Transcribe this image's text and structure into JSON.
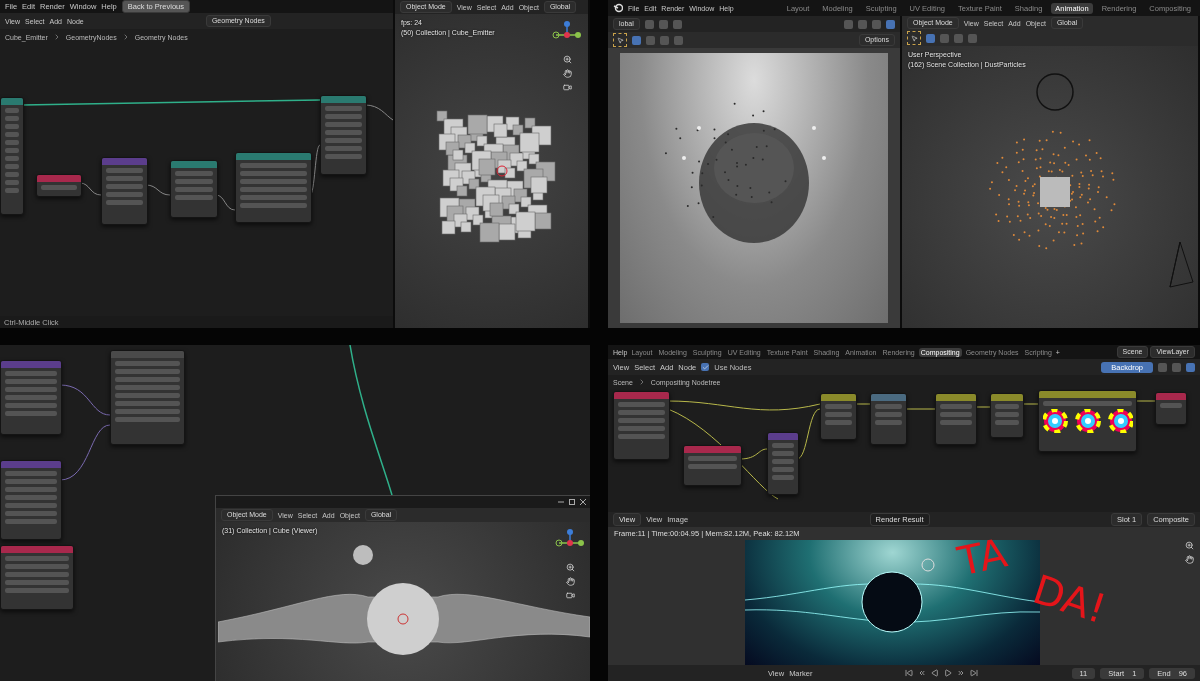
{
  "top_left": {
    "menu": [
      "File",
      "Edit",
      "Render",
      "Window",
      "Help"
    ],
    "back_button": "Back to Previous",
    "editor_menus": [
      "View",
      "Select",
      "Add",
      "Node"
    ],
    "node_group": "Geometry Nodes",
    "breadcrumb": [
      "Cube_Emitter",
      "GeometryNodes",
      "Geometry Nodes"
    ],
    "nodes": [
      {
        "color": "#2a7a70"
      },
      {
        "color": "#a8284c"
      },
      {
        "color": "#5b3d8c"
      },
      {
        "color": "#2a7a70"
      },
      {
        "color": "#2a7a70"
      },
      {
        "color": "#2a7a70"
      }
    ],
    "status": "Ctrl-Middle Click",
    "viewport": {
      "mode": "Object Mode",
      "menus": [
        "View",
        "Select",
        "Add",
        "Object"
      ],
      "orientation": "Global",
      "overlay": [
        "fps: 24",
        "(50) Collection | Cube_Emitter"
      ]
    }
  },
  "top_right": {
    "menu": [
      "File",
      "Edit",
      "Render",
      "Window",
      "Help"
    ],
    "workspace_tabs": [
      {
        "label": "Layout",
        "selected": false
      },
      {
        "label": "Modeling",
        "selected": false
      },
      {
        "label": "Sculpting",
        "selected": false
      },
      {
        "label": "UV Editing",
        "selected": false
      },
      {
        "label": "Texture Paint",
        "selected": false
      },
      {
        "label": "Shading",
        "selected": false
      },
      {
        "label": "Animation",
        "selected": true
      },
      {
        "label": "Rendering",
        "selected": false
      },
      {
        "label": "Compositing",
        "selected": false
      }
    ],
    "left_viewport": {
      "orientation": "lobal",
      "options": "Options"
    },
    "right_viewport": {
      "mode": "Object Mode",
      "menus": [
        "View",
        "Select",
        "Add",
        "Object"
      ],
      "orientation": "Global",
      "overlay": [
        "User Perspective",
        "(162) Scene Collection | DustParticles"
      ]
    }
  },
  "bottom_left": {
    "nodes": [
      {
        "color": "#5b3d8c"
      },
      {
        "color": "#4a4a4a"
      },
      {
        "color": "#5b3d8c"
      },
      {
        "color": "#a8284c"
      }
    ],
    "viewport_window": {
      "mode": "Object Mode",
      "menus": [
        "View",
        "Select",
        "Add",
        "Object"
      ],
      "orientation": "Global",
      "overlay": [
        "(31) Collection | Cube (Viewer)"
      ]
    }
  },
  "bottom_right": {
    "menu": [
      "Help"
    ],
    "workspace_tabs": [
      {
        "label": "Layout",
        "selected": false
      },
      {
        "label": "Modeling",
        "selected": false
      },
      {
        "label": "Sculpting",
        "selected": false
      },
      {
        "label": "UV Editing",
        "selected": false
      },
      {
        "label": "Texture Paint",
        "selected": false
      },
      {
        "label": "Shading",
        "selected": false
      },
      {
        "label": "Animation",
        "selected": false
      },
      {
        "label": "Rendering",
        "selected": false
      },
      {
        "label": "Compositing",
        "selected": true
      },
      {
        "label": "Geometry Nodes",
        "selected": false
      },
      {
        "label": "Scripting",
        "selected": false
      }
    ],
    "add_tab": "+",
    "scene": "Scene",
    "view_layer": "ViewLayer",
    "editor_menus": [
      "View",
      "Select",
      "Add",
      "Node"
    ],
    "use_nodes": {
      "label": "Use Nodes",
      "checked": true
    },
    "backdrop_button": "Backdrop",
    "breadcrumb": [
      "Scene",
      "Compositing Nodetree"
    ],
    "nodes": [
      {
        "color": "#a8284c"
      },
      {
        "color": "#a8284c"
      },
      {
        "color": "#5b3d8c"
      },
      {
        "color": "#8a8a2a"
      },
      {
        "color": "#4a6a80"
      },
      {
        "color": "#8a8a2a"
      },
      {
        "color": "#8a8a2a"
      },
      {
        "color": "#8a8a2a"
      },
      {
        "color": "#a8284c"
      }
    ],
    "image_editor": {
      "mode": "View",
      "menus": [
        "View",
        "Image"
      ],
      "image": "Render Result",
      "slot": "Slot 1",
      "pass": "Composite",
      "info": "Frame:11 | Time:00:04.95 | Mem:82.12M, Peak: 82.12M",
      "annotation": [
        "TA",
        "DA!"
      ]
    },
    "timeline": {
      "menus": [
        "View",
        "Marker"
      ],
      "current_frame": "11",
      "start_label": "Start",
      "start": "1",
      "end_label": "End",
      "end": "96"
    }
  }
}
